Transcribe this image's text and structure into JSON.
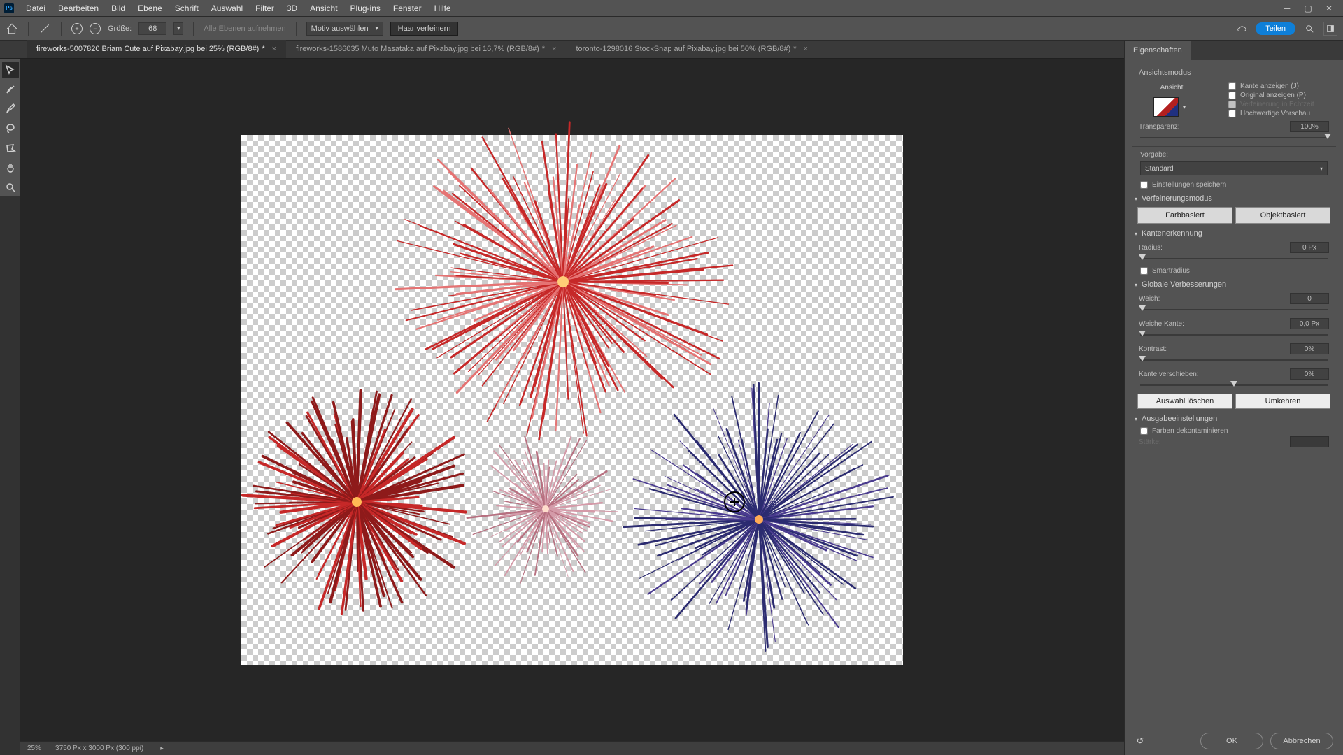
{
  "menu": {
    "items": [
      "Datei",
      "Bearbeiten",
      "Bild",
      "Ebene",
      "Schrift",
      "Auswahl",
      "Filter",
      "3D",
      "Ansicht",
      "Plug-ins",
      "Fenster",
      "Hilfe"
    ]
  },
  "options": {
    "size_label": "Größe:",
    "size_value": "68",
    "all_layers": "Alle Ebenen aufnehmen",
    "select_subject": "Motiv auswählen",
    "refine_hair": "Haar verfeinern",
    "share": "Teilen"
  },
  "tabs": [
    {
      "label": "fireworks-5007820 Briam Cute auf Pixabay.jpg bei 25% (RGB/8#)",
      "dirty": "*",
      "active": true
    },
    {
      "label": "fireworks-1586035 Muto Masataka auf Pixabay.jpg bei 16,7% (RGB/8#)",
      "dirty": "*",
      "active": false
    },
    {
      "label": "toronto-1298016 StockSnap auf Pixabay.jpg bei 50% (RGB/8#)",
      "dirty": "*",
      "active": false
    }
  ],
  "properties": {
    "panel_title": "Eigenschaften",
    "view_mode": "Ansichtsmodus",
    "show_edge": "Kante anzeigen (J)",
    "show_original": "Original anzeigen (P)",
    "realtime": "Verfeinerung in Echtzeit",
    "hq_preview": "Hochwertige Vorschau",
    "view_label": "Ansicht",
    "transparency": "Transparenz:",
    "transparency_val": "100%",
    "preset_label": "Vorgabe:",
    "preset_val": "Standard",
    "remember": "Einstellungen speichern",
    "refine_mode": "Verfeinerungsmodus",
    "color_based": "Farbbasiert",
    "object_based": "Objektbasiert",
    "edge_detect": "Kantenerkennung",
    "radius": "Radius:",
    "radius_val": "0 Px",
    "smart_radius": "Smartradius",
    "global": "Globale Verbesserungen",
    "smooth": "Weich:",
    "smooth_val": "0",
    "feather": "Weiche Kante:",
    "feather_val": "0,0 Px",
    "contrast": "Kontrast:",
    "contrast_val": "0%",
    "shift_edge": "Kante verschieben:",
    "shift_edge_val": "0%",
    "clear_sel": "Auswahl löschen",
    "invert": "Umkehren",
    "output": "Ausgabeeinstellungen",
    "decontaminate": "Farben dekontaminieren",
    "amount": "Stärke:",
    "ok": "OK",
    "cancel": "Abbrechen"
  },
  "status": {
    "zoom": "25%",
    "doc": "3750 Px x 3000 Px (300 ppi)"
  }
}
